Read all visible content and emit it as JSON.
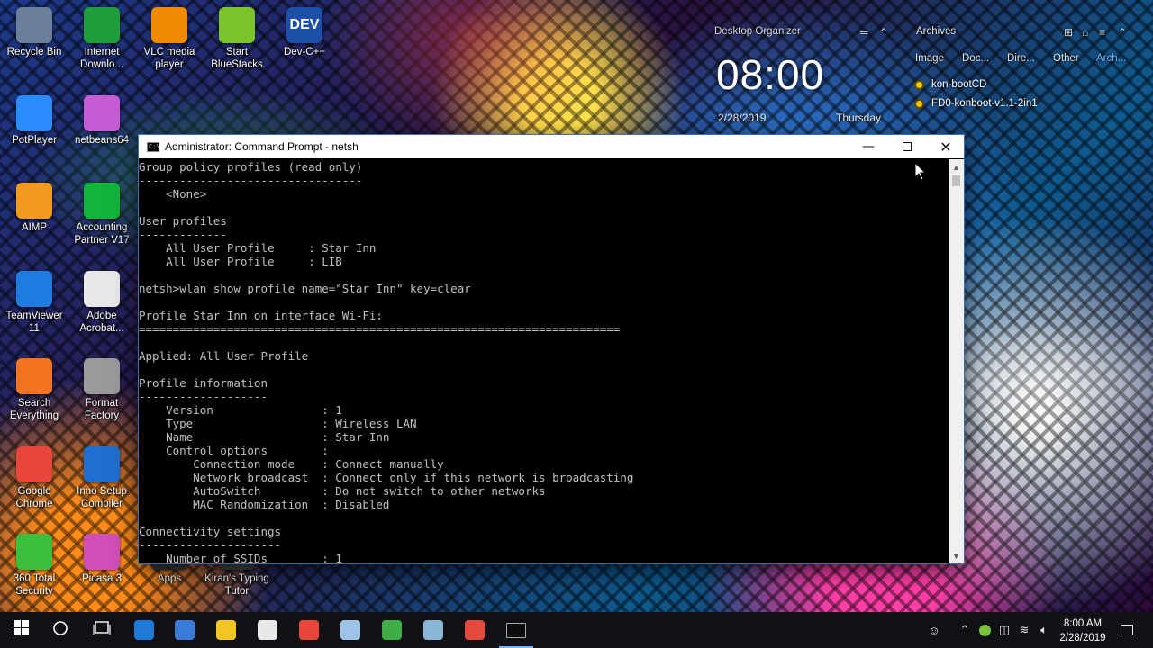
{
  "desktop": {
    "icons": [
      {
        "label": "Recycle Bin",
        "glyph": "recycle-bin-icon",
        "color": "#6a7f9a"
      },
      {
        "label": "Internet Downlo...",
        "glyph": "internet-download-manager-icon",
        "color": "#1f9d3a"
      },
      {
        "label": "VLC media player",
        "glyph": "vlc-icon",
        "color": "#f08a00"
      },
      {
        "label": "Start BlueStacks",
        "glyph": "bluestacks-icon",
        "color": "#7bc42b"
      },
      {
        "label": "Dev-C++",
        "glyph": "devcpp-icon",
        "color": "#1b4fa8",
        "text": "DEV"
      },
      {
        "label": "PotPlayer",
        "glyph": "potplayer-icon",
        "color": "#2a8cff"
      },
      {
        "label": "netbeans64",
        "glyph": "netbeans-icon",
        "color": "#c65bd6"
      },
      {
        "label": "AIMP",
        "glyph": "aimp-icon",
        "color": "#f39a1e"
      },
      {
        "label": "Accounting Partner V17",
        "glyph": "sage-icon",
        "color": "#10b53a"
      },
      {
        "label": "TeamViewer 11",
        "glyph": "teamviewer-icon",
        "color": "#1e7be0"
      },
      {
        "label": "Adobe Acrobat...",
        "glyph": "acrobat-icon",
        "color": "#e8e8e8"
      },
      {
        "label": "Search Everything",
        "glyph": "everything-search-icon",
        "color": "#f37320"
      },
      {
        "label": "Format Factory",
        "glyph": "format-factory-icon",
        "color": "#9a9a9a"
      },
      {
        "label": "Google Chrome",
        "glyph": "chrome-icon",
        "color": "#e8463a"
      },
      {
        "label": "Inno Setup Compiler",
        "glyph": "inno-setup-icon",
        "color": "#1e6fd0"
      },
      {
        "label": "360 Total Security",
        "glyph": "360-security-icon",
        "color": "#3cbf3c"
      },
      {
        "label": "Picasa 3",
        "glyph": "picasa-icon",
        "color": "#d04fb8"
      },
      {
        "label": "Apps",
        "glyph": "apps-folder-icon",
        "color": "#3a3a3a"
      },
      {
        "label": "Kiran's Typing Tutor",
        "glyph": "typing-tutor-icon",
        "color": "#444"
      }
    ]
  },
  "organizer": {
    "title": "Desktop Organizer",
    "clock_time": "08:00",
    "clock_date": "2/28/2019",
    "clock_day": "Thursday",
    "archives_title": "Archives",
    "archive_tabs": [
      "Image",
      "Doc...",
      "Dire...",
      "Other",
      "Arch..."
    ],
    "archive_items": [
      "kon-bootCD",
      "FD0-konboot-v1.1-2in1"
    ]
  },
  "cmd": {
    "title": "Administrator: Command Prompt - netsh",
    "lines": [
      "Group policy profiles (read only)",
      "---------------------------------",
      "    <None>",
      "",
      "User profiles",
      "-------------",
      "    All User Profile     : Star Inn",
      "    All User Profile     : LIB",
      "",
      "netsh>wlan show profile name=\"Star Inn\" key=clear",
      "",
      "Profile Star Inn on interface Wi-Fi:",
      "=======================================================================",
      "",
      "Applied: All User Profile",
      "",
      "Profile information",
      "-------------------",
      "    Version                : 1",
      "    Type                   : Wireless LAN",
      "    Name                   : Star Inn",
      "    Control options        :",
      "        Connection mode    : Connect manually",
      "        Network broadcast  : Connect only if this network is broadcasting",
      "        AutoSwitch         : Do not switch to other networks",
      "        MAC Randomization  : Disabled",
      "",
      "Connectivity settings",
      "---------------------",
      "    Number of SSIDs        : 1"
    ]
  },
  "taskbar": {
    "clock_time": "8:00 AM",
    "clock_date": "2/28/2019",
    "pinned": [
      {
        "name": "start-button",
        "icon": "windows-icon"
      },
      {
        "name": "search-button",
        "icon": "cortana-icon"
      },
      {
        "name": "task-view-button",
        "icon": "task-view-icon"
      },
      {
        "name": "edge-button",
        "icon": "edge-icon",
        "color": "#1e7ad6"
      },
      {
        "name": "store-button",
        "icon": "store-icon",
        "color": "#3b7bd8"
      },
      {
        "name": "file-explorer-button",
        "icon": "folder-icon",
        "color": "#f3c623"
      },
      {
        "name": "mail-button",
        "icon": "mail-icon",
        "color": "#e8e8e8"
      },
      {
        "name": "chrome-button",
        "icon": "chrome-icon",
        "color": "#e8463a"
      },
      {
        "name": "notepad-button",
        "icon": "notepad-icon",
        "color": "#9dc3e6"
      },
      {
        "name": "camtasia-button",
        "icon": "camtasia-icon",
        "color": "#3fae49"
      },
      {
        "name": "app-button",
        "icon": "app-icon",
        "color": "#8ab6d6"
      },
      {
        "name": "recorder-button",
        "icon": "recorder-icon",
        "color": "#e44b3a"
      },
      {
        "name": "cmd-button",
        "icon": "cmd-icon",
        "color": "#111111"
      }
    ]
  }
}
